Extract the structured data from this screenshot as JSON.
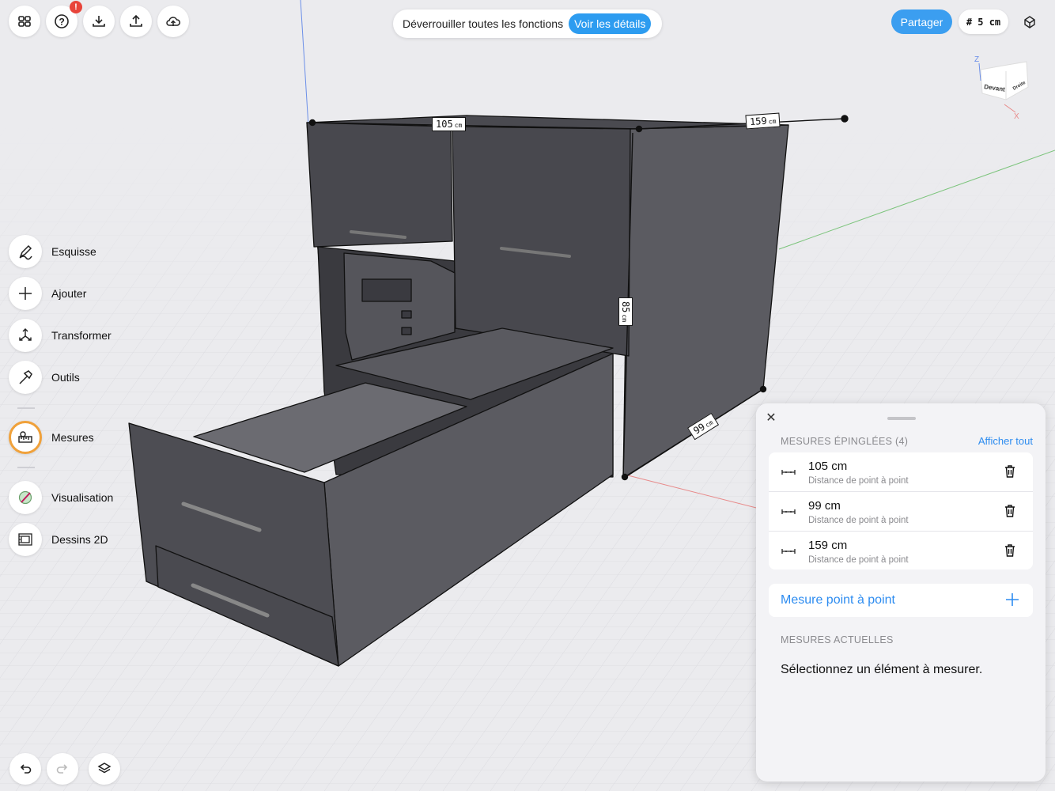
{
  "toolbar": {
    "unlock_text": "Déverrouiller toutes les fonctions",
    "details_label": "Voir les détails",
    "share_label": "Partager",
    "grid_size": "# 5 cm",
    "help_badge": "!"
  },
  "sidebar": {
    "items": [
      {
        "label": "Esquisse",
        "icon": "pencil-icon"
      },
      {
        "label": "Ajouter",
        "icon": "plus-icon"
      },
      {
        "label": "Transformer",
        "icon": "transform-icon"
      },
      {
        "label": "Outils",
        "icon": "hammer-icon"
      },
      {
        "label": "Mesures",
        "icon": "measure-icon",
        "active": true
      },
      {
        "label": "Visualisation",
        "icon": "paint-icon"
      },
      {
        "label": "Dessins 2D",
        "icon": "blueprint-icon"
      }
    ]
  },
  "viewcube": {
    "front": "Devant",
    "right": "Droite",
    "axis_z": "Z",
    "axis_x": "X"
  },
  "dimensions": {
    "d105": {
      "value": "105",
      "unit": "cm"
    },
    "d159": {
      "value": "159",
      "unit": "cm"
    },
    "d85": {
      "value": "85",
      "unit": "cm"
    },
    "d99": {
      "value": "99",
      "unit": "cm"
    }
  },
  "panel": {
    "pinned_title": "MESURES ÉPINGLÉES (4)",
    "show_all": "Afficher tout",
    "pinned": [
      {
        "value": "105 cm",
        "desc": "Distance de point à point"
      },
      {
        "value": "99 cm",
        "desc": "Distance de point à point"
      },
      {
        "value": "159 cm",
        "desc": "Distance de point à point"
      }
    ],
    "add_label": "Mesure point à point",
    "current_title": "MESURES ACTUELLES",
    "select_msg": "Sélectionnez un élément à mesurer."
  },
  "colors": {
    "accent": "#2d9cf0",
    "active_ring": "#f0a13a",
    "model_dark": "#4a4a50",
    "badge": "#e8443a"
  }
}
